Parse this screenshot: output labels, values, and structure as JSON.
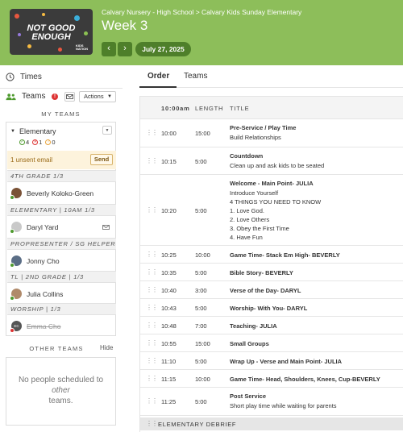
{
  "header": {
    "thumb_title_line1": "NOT GOOD",
    "thumb_title_line2": "ENOUGH",
    "thumb_brand_line1": "KIDS",
    "thumb_brand_line2": "NATION",
    "breadcrumb": [
      "Calvary Nursery - High School",
      "Calvary Kids Sunday Elementary"
    ],
    "breadcrumb_sep": ">",
    "title": "Week 3",
    "prev_icon": "‹",
    "next_icon": "›",
    "date": "July 27, 2025",
    "bg_color": "#8dbe5a",
    "button_color": "#4e7f2a"
  },
  "sidebar": {
    "times_label": "Times",
    "teams_label": "Teams",
    "actions_label": "Actions",
    "my_teams_label": "MY TEAMS",
    "team_name": "Elementary",
    "counts": {
      "confirmed": "4",
      "declined": "1",
      "pending": "0"
    },
    "unsent_text": "1 unsent email",
    "send_label": "Send",
    "groups": [
      {
        "label": "4th Grade 1/3",
        "people": [
          {
            "name": "Beverly Koloko-Green",
            "status": "confirmed",
            "mail": false,
            "declined": false
          }
        ]
      },
      {
        "label": "Elementary | 10am 1/3",
        "people": [
          {
            "name": "Daryl Yard",
            "status": "confirmed",
            "mail": true,
            "declined": false
          }
        ]
      },
      {
        "label": "Propresenter / SG Helpers",
        "people": [
          {
            "name": "Jonny Cho",
            "status": "confirmed",
            "mail": false,
            "declined": false
          }
        ]
      },
      {
        "label": "TL | 2nd Grade | 1/3",
        "people": [
          {
            "name": "Julia Collins",
            "status": "confirmed",
            "mail": false,
            "declined": false
          }
        ]
      },
      {
        "label": "Worship | 1/3",
        "people": [
          {
            "name": "Emma Cho",
            "status": "declined",
            "mail": false,
            "declined": true,
            "initials": "EC"
          }
        ]
      }
    ],
    "other_teams_label": "OTHER TEAMS",
    "hide_label": "Hide",
    "other_empty_pre": "No people scheduled to",
    "other_empty_em": "other",
    "other_empty_post": "teams."
  },
  "main": {
    "tabs": [
      {
        "label": "Order",
        "active": true
      },
      {
        "label": "Teams",
        "active": false
      }
    ],
    "columns": {
      "time": "10:00am",
      "length": "LENGTH",
      "title": "TITLE"
    },
    "rows": [
      {
        "time": "10:00",
        "length": "15:00",
        "title": "Pre-Service / Play Time",
        "desc": [
          "Build Relationships"
        ]
      },
      {
        "time": "10:15",
        "length": "5:00",
        "title": "Countdown",
        "desc": [
          "Clean up and ask kids to be seated"
        ]
      },
      {
        "time": "10:20",
        "length": "5:00",
        "title": "Welcome - Main Point- JULIA",
        "desc": [
          "Introduce Yourself",
          "4 THINGS YOU NEED TO KNOW",
          "1. Love God.",
          "2. Love Others",
          "3. Obey the First Time",
          "4. Have Fun"
        ]
      },
      {
        "time": "10:25",
        "length": "10:00",
        "title": "Game Time- Stack Em High- BEVERLY",
        "desc": []
      },
      {
        "time": "10:35",
        "length": "5:00",
        "title": "Bible Story- BEVERLY",
        "desc": []
      },
      {
        "time": "10:40",
        "length": "3:00",
        "title": "Verse of the Day- DARYL",
        "desc": []
      },
      {
        "time": "10:43",
        "length": "5:00",
        "title": "Worship- With You- DARYL",
        "desc": []
      },
      {
        "time": "10:48",
        "length": "7:00",
        "title": "Teaching- JULIA",
        "desc": []
      },
      {
        "time": "10:55",
        "length": "15:00",
        "title": "Small Groups",
        "desc": []
      },
      {
        "time": "11:10",
        "length": "5:00",
        "title": "Wrap Up - Verse and Main Point- JULIA",
        "desc": []
      },
      {
        "time": "11:15",
        "length": "10:00",
        "title": "Game Time- Head, Shoulders, Knees, Cup-BEVERLY",
        "desc": []
      },
      {
        "time": "11:25",
        "length": "5:00",
        "title": "Post Service",
        "desc": [
          "Short play time while waiting for parents"
        ]
      }
    ],
    "section_header": "ELEMENTARY DEBRIEF"
  },
  "icons": {
    "times": "clock-icon",
    "teams": "people-icon",
    "alert": "alert-icon",
    "mail": "mail-icon",
    "grip": "drag-handle-icon"
  }
}
